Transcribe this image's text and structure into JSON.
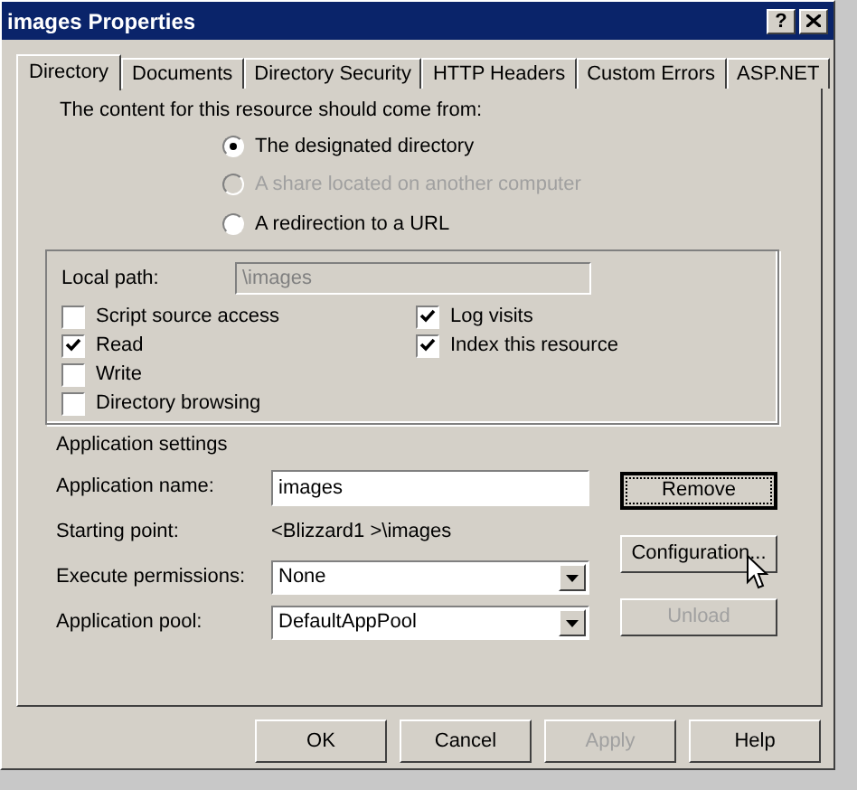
{
  "window": {
    "title": "images Properties",
    "help": "?"
  },
  "tabs": [
    {
      "label": "Directory",
      "selected": true
    },
    {
      "label": "Documents",
      "selected": false
    },
    {
      "label": "Directory Security",
      "selected": false
    },
    {
      "label": "HTTP Headers",
      "selected": false
    },
    {
      "label": "Custom Errors",
      "selected": false
    },
    {
      "label": "ASP.NET",
      "selected": false
    }
  ],
  "content_source": {
    "label": "The content for this resource should come from:",
    "options": [
      {
        "label": "The designated directory",
        "selected": true,
        "disabled": false
      },
      {
        "label": "A share located on another computer",
        "selected": false,
        "disabled": true
      },
      {
        "label": "A redirection to a URL",
        "selected": false,
        "disabled": false
      }
    ]
  },
  "local_path": {
    "label": "Local path:",
    "value": "\\images",
    "disabled": true
  },
  "left_checks": [
    {
      "label": "Script source access",
      "checked": false
    },
    {
      "label": "Read",
      "checked": true
    },
    {
      "label": "Write",
      "checked": false
    },
    {
      "label": "Directory browsing",
      "checked": false
    }
  ],
  "right_checks": [
    {
      "label": "Log visits",
      "checked": true
    },
    {
      "label": "Index this resource",
      "checked": true
    }
  ],
  "application_settings": {
    "heading": "Application settings",
    "fields": [
      {
        "kind": "text",
        "label": "Application name:",
        "value": "images"
      },
      {
        "kind": "static",
        "label": "Starting point:",
        "value": "<Blizzard1 >\\images"
      },
      {
        "kind": "select",
        "label": "Execute permissions:",
        "value": "None"
      },
      {
        "kind": "select",
        "label": "Application pool:",
        "value": "DefaultAppPool"
      }
    ],
    "buttons": [
      {
        "label": "Remove",
        "disabled": false,
        "focused": true
      },
      {
        "label": "Configuration...",
        "disabled": false,
        "focused": false
      },
      {
        "label": "Unload",
        "disabled": true,
        "focused": false
      }
    ]
  },
  "footer_buttons": [
    {
      "label": "OK",
      "disabled": false
    },
    {
      "label": "Cancel",
      "disabled": false
    },
    {
      "label": "Apply",
      "disabled": true
    },
    {
      "label": "Help",
      "disabled": false
    }
  ]
}
